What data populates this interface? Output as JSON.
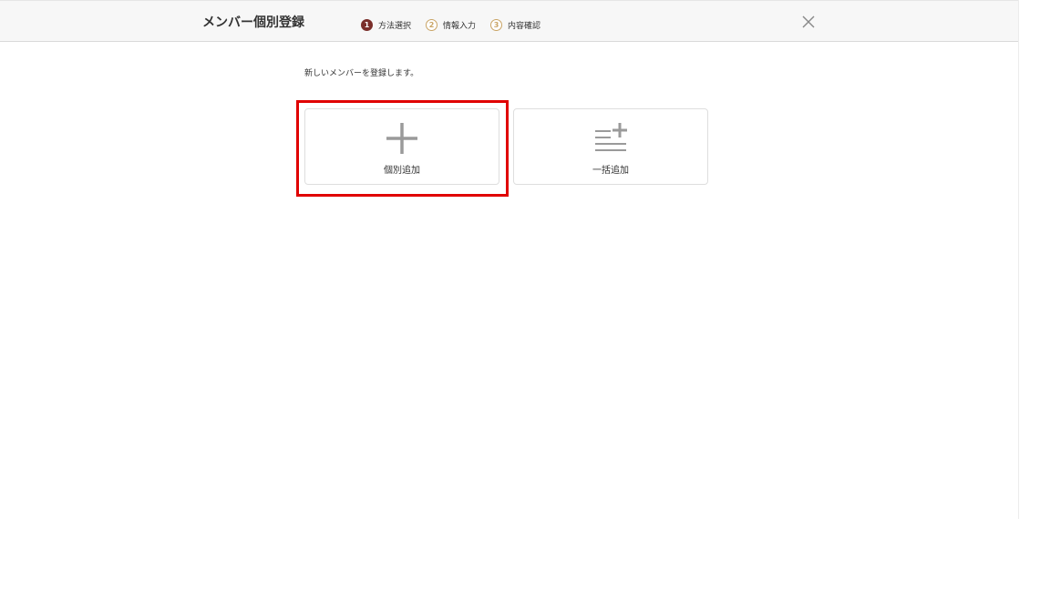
{
  "modal": {
    "title": "メンバー個別登録",
    "steps": [
      {
        "number": "1",
        "label": "方法選択",
        "state": "active"
      },
      {
        "number": "2",
        "label": "情報入力",
        "state": "inactive"
      },
      {
        "number": "3",
        "label": "内容確認",
        "state": "inactive"
      }
    ],
    "close_icon": "close-icon",
    "intro_text": "新しいメンバーを登録します。",
    "options": [
      {
        "label": "個別追加",
        "icon": "plus-icon",
        "highlighted": true
      },
      {
        "label": "一括追加",
        "icon": "list-plus-icon",
        "highlighted": false
      }
    ]
  },
  "colors": {
    "header_bg": "#f7f7f7",
    "step_active": "#7a2e2a",
    "step_inactive": "#c9a465",
    "icon_gray": "#9a9a9a",
    "highlight_red": "#e00000"
  }
}
